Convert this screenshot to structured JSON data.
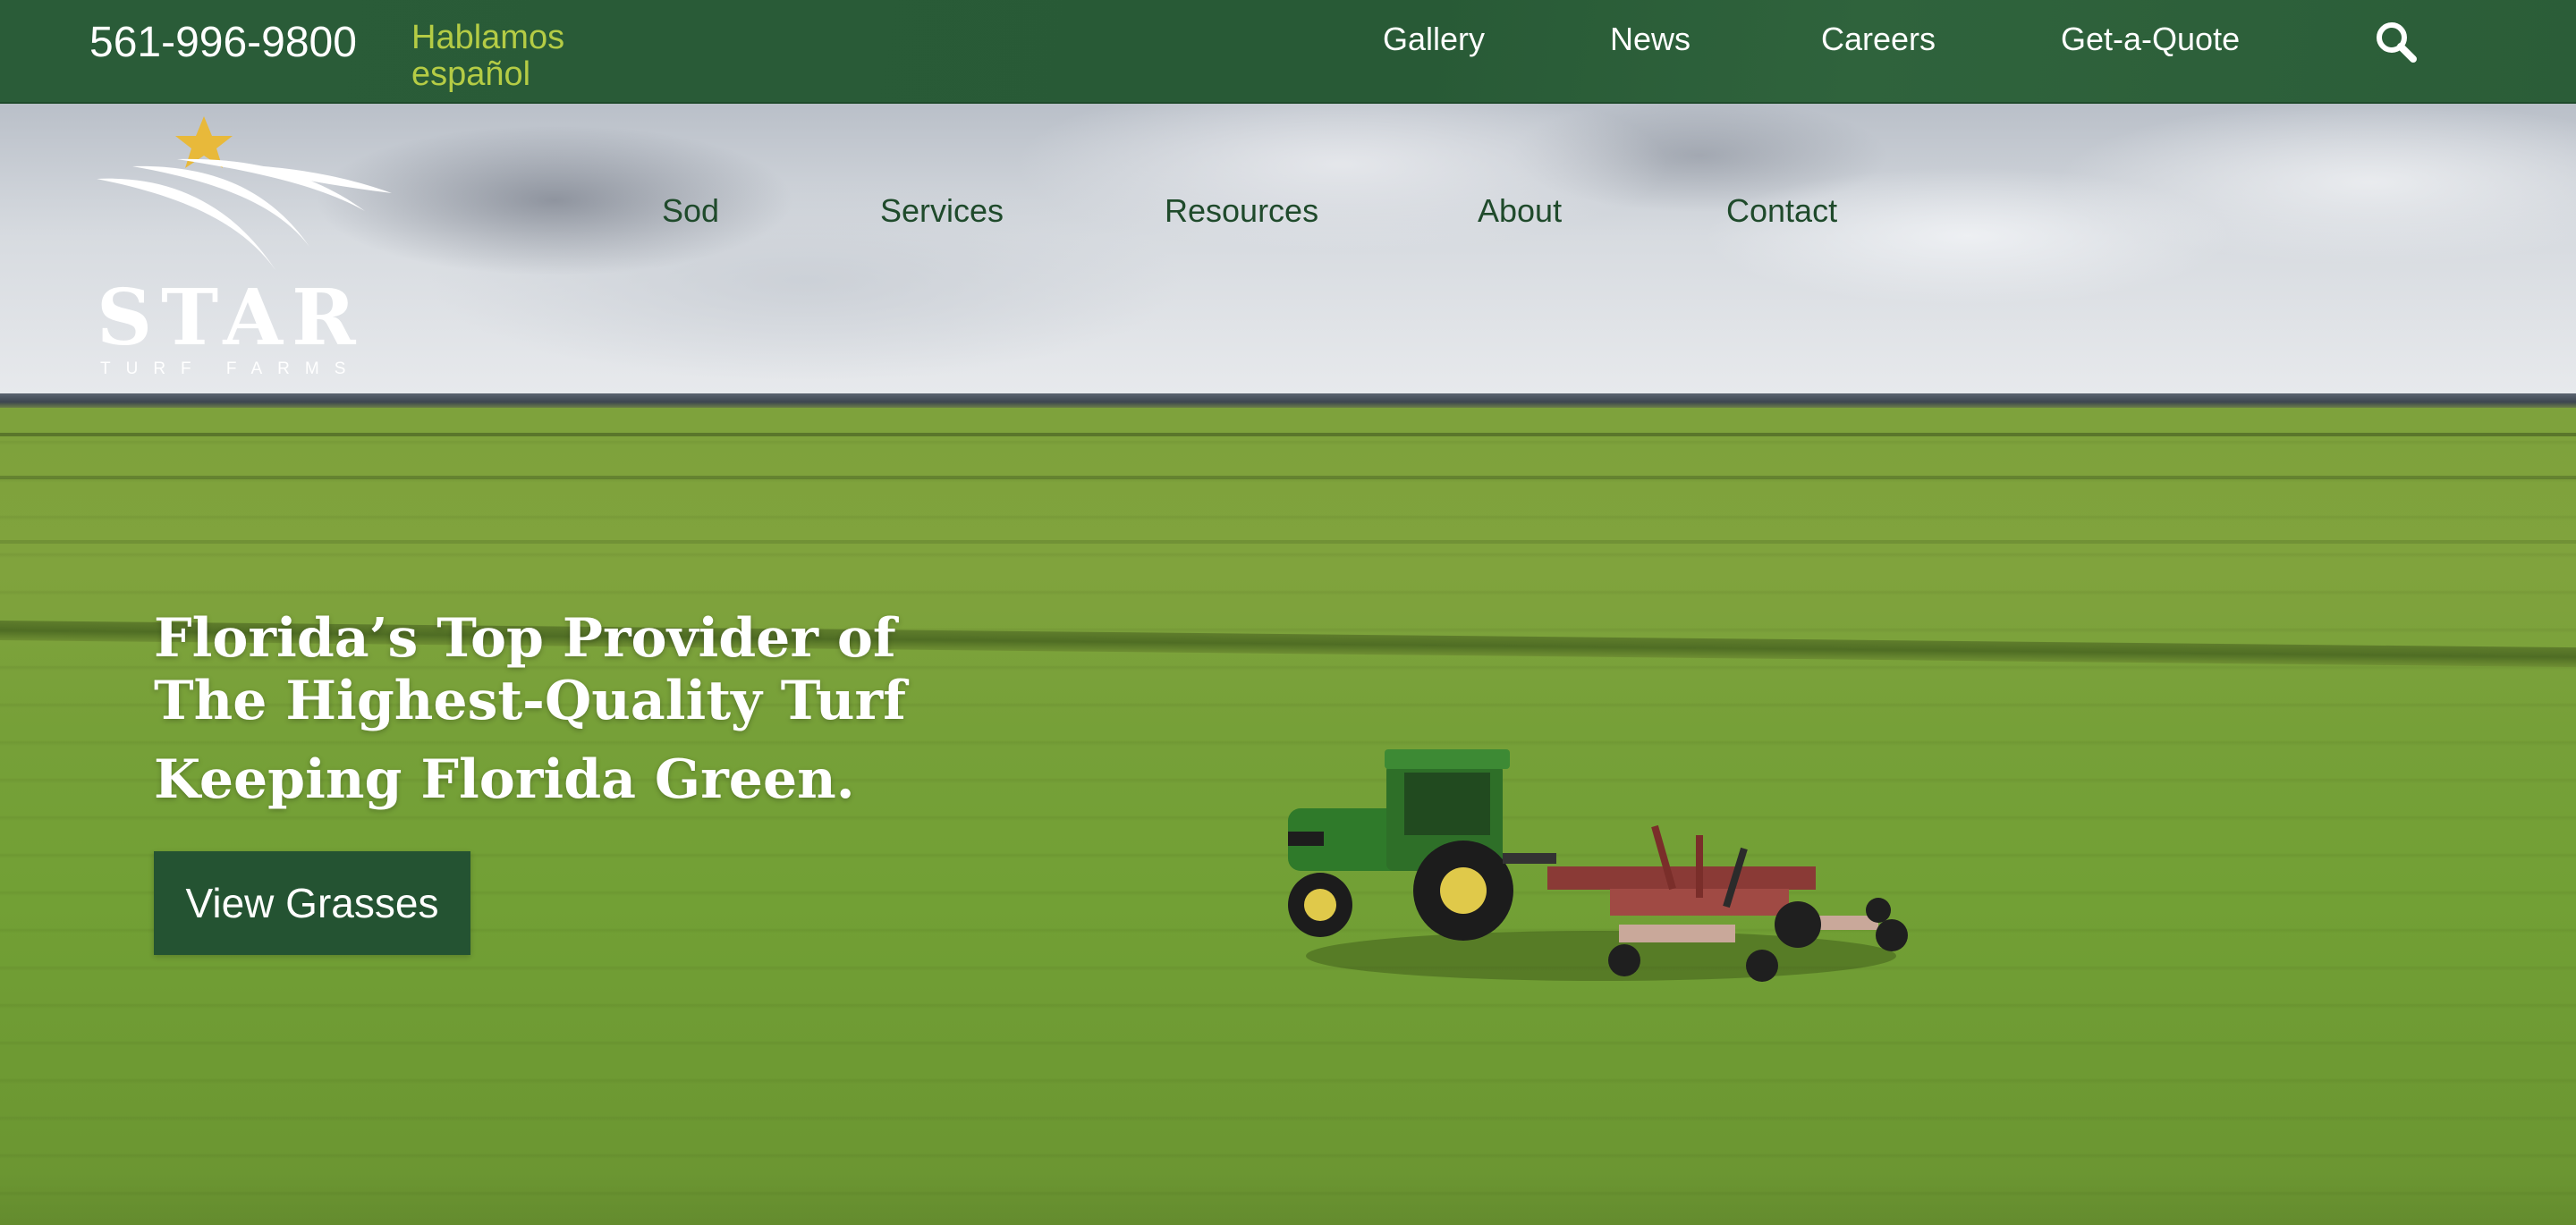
{
  "topbar": {
    "phone": "561-996-9800",
    "hablamos": "Hablamos español",
    "links": [
      {
        "label": "Gallery"
      },
      {
        "label": "News"
      },
      {
        "label": "Careers"
      },
      {
        "label": "Get-a-Quote"
      }
    ],
    "search_icon": "search-icon"
  },
  "logo": {
    "word": "STAR",
    "sub": "TURF FARMS"
  },
  "main_nav": {
    "links": [
      {
        "label": "Sod"
      },
      {
        "label": "Services"
      },
      {
        "label": "Resources"
      },
      {
        "label": "About"
      },
      {
        "label": "Contact"
      }
    ]
  },
  "hero": {
    "headline_line1": "Florida’s Top Provider of",
    "headline_line2": "The Highest-Quality Turf",
    "headline_line3": "Keeping Florida Green.",
    "cta_label": "View Grasses"
  },
  "colors": {
    "topbar": "#2a5c38",
    "accent_yellow_green": "#b5cc45",
    "nav_text": "#1f4a2b",
    "button": "#245332",
    "star": "#e8b93a"
  }
}
